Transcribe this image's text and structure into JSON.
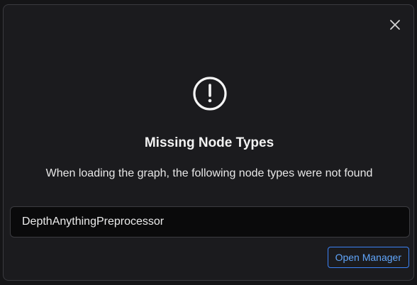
{
  "dialog": {
    "title": "Missing Node Types",
    "message": "When loading the graph, the following node types were not found",
    "missing_nodes": [
      "DepthAnythingPreprocessor"
    ],
    "open_manager_label": "Open Manager",
    "icon": "warning-circle-icon",
    "close_icon": "close-icon"
  },
  "colors": {
    "accent": "#3b82f6",
    "dialog_bg": "#1b1b1e",
    "list_bg": "#0a0a0b"
  }
}
